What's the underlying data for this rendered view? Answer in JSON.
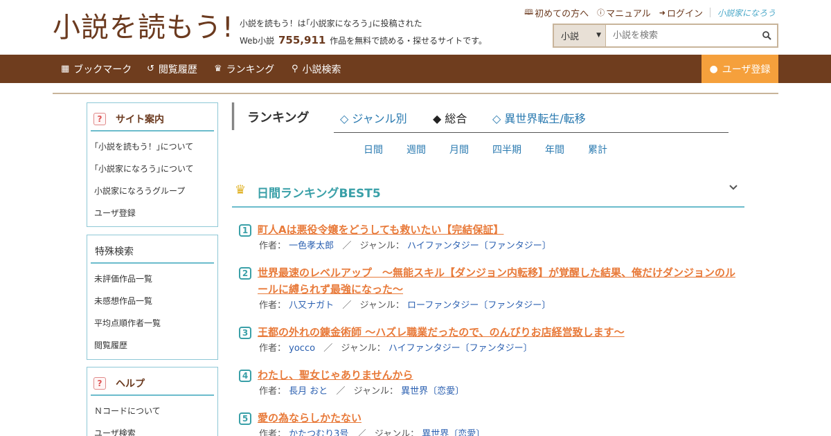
{
  "header": {
    "logo": "小説を読もう!",
    "tagline_line1": "小説を読もう！は｢小説家になろう｣に投稿された",
    "tagline_prefix": "Web小説",
    "tagline_count": "755,911",
    "tagline_suffix": "作品を無料で読める・探せるサイトです。",
    "toplinks": [
      {
        "icon": "book-icon",
        "label": "初めての方へ"
      },
      {
        "icon": "question-icon",
        "label": "マニュアル"
      },
      {
        "icon": "login-icon",
        "label": "ログイン"
      }
    ],
    "brand_logo": "小説家になろう",
    "search": {
      "select_value": "小説",
      "placeholder": "小説を検索"
    }
  },
  "nav": {
    "items": [
      {
        "icon": "bookmark-icon",
        "label": "ブックマーク"
      },
      {
        "icon": "history-icon",
        "label": "閲覧履歴"
      },
      {
        "icon": "crown-icon",
        "label": "ランキング"
      },
      {
        "icon": "search-icon",
        "label": "小説検索"
      }
    ],
    "register": "ユーザ登録"
  },
  "sidebar": {
    "site_info": {
      "title": "サイト案内",
      "items": [
        "｢小説を読もう！｣について",
        "｢小説家になろう｣について",
        "小説家になろうグループ",
        "ユーザ登録"
      ]
    },
    "special_search": {
      "title": "特殊検索",
      "items": [
        "未評価作品一覧",
        "未感想作品一覧",
        "平均点順作者一覧",
        "閲覧履歴"
      ]
    },
    "help": {
      "title": "ヘルプ",
      "items": [
        "Ｎコードについて",
        "ユーザ検索"
      ]
    }
  },
  "ranking": {
    "title": "ランキング",
    "tabs": [
      "◇ ジャンル別",
      "◆ 総合",
      "◇ 異世界転生/転移"
    ],
    "periods": [
      "日間",
      "週間",
      "月間",
      "四半期",
      "年間",
      "累計"
    ],
    "best_title": "日間ランキングBEST5",
    "author_label": "作者：",
    "genre_label": "ジャンル：",
    "entries": [
      {
        "rank": "1",
        "title": "町人Aは悪役令嬢をどうしても救いたい【完結保証】",
        "author": "一色孝太郎",
        "genre": "ハイファンタジー〔ファンタジー〕"
      },
      {
        "rank": "2",
        "title": "世界最速のレベルアップ　～無能スキル【ダンジョン内転移】が覚醒した結果、俺だけダンジョンのルールに縛られず最強になった～",
        "author": "八又ナガト",
        "genre": "ローファンタジー〔ファンタジー〕"
      },
      {
        "rank": "3",
        "title": "王都の外れの錬金術師 ～ハズレ職業だったので、のんびりお店経営致します～",
        "author": "yocco",
        "genre": "ハイファンタジー〔ファンタジー〕"
      },
      {
        "rank": "4",
        "title": "わたし、聖女じゃありませんから",
        "author": "長月 おと",
        "genre": "異世界〔恋愛〕"
      },
      {
        "rank": "5",
        "title": "愛の為ならしかたない",
        "author": "かたつむり3号",
        "genre": "異世界〔恋愛〕"
      }
    ]
  }
}
